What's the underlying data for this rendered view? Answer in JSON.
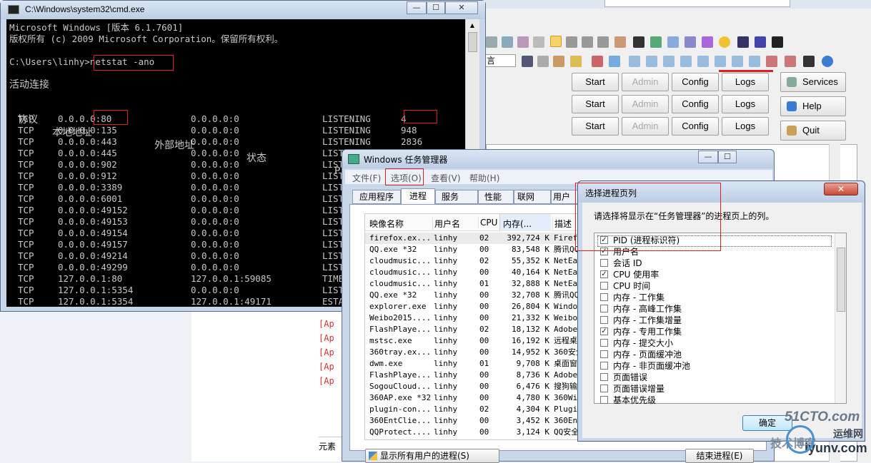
{
  "cmd": {
    "title": "C:\\Windows\\system32\\cmd.exe",
    "line1": "Microsoft Windows [版本 6.1.7601]",
    "line2": "版权所有 (c) 2009 Microsoft Corporation。保留所有权利。",
    "prompt": "C:\\Users\\linhy>",
    "command": "netstat -ano",
    "section": "活动连接",
    "headers": [
      "协议",
      "本地地址",
      "外部地址",
      "状态",
      "PID"
    ],
    "rows": [
      [
        "TCP",
        "0.0.0.0:80",
        "0.0.0.0:0",
        "LISTENING",
        "4"
      ],
      [
        "TCP",
        "0.0.0.0:135",
        "0.0.0.0:0",
        "LISTENING",
        "948"
      ],
      [
        "TCP",
        "0.0.0.0:443",
        "0.0.0.0:0",
        "LISTENING",
        "2836"
      ],
      [
        "TCP",
        "0.0.0.0:445",
        "0.0.0.0:0",
        "LIST",
        ""
      ],
      [
        "TCP",
        "0.0.0.0:902",
        "0.0.0.0:0",
        "LIST",
        ""
      ],
      [
        "TCP",
        "0.0.0.0:912",
        "0.0.0.0:0",
        "LIST",
        ""
      ],
      [
        "TCP",
        "0.0.0.0:3389",
        "0.0.0.0:0",
        "LIST",
        ""
      ],
      [
        "TCP",
        "0.0.0.0:6001",
        "0.0.0.0:0",
        "LIST",
        ""
      ],
      [
        "TCP",
        "0.0.0.0:49152",
        "0.0.0.0:0",
        "LIST",
        ""
      ],
      [
        "TCP",
        "0.0.0.0:49153",
        "0.0.0.0:0",
        "LIST",
        ""
      ],
      [
        "TCP",
        "0.0.0.0:49154",
        "0.0.0.0:0",
        "LIST",
        ""
      ],
      [
        "TCP",
        "0.0.0.0:49157",
        "0.0.0.0:0",
        "LIST",
        ""
      ],
      [
        "TCP",
        "0.0.0.0:49214",
        "0.0.0.0:0",
        "LIST",
        ""
      ],
      [
        "TCP",
        "0.0.0.0:49299",
        "0.0.0.0:0",
        "LIST",
        ""
      ],
      [
        "TCP",
        "127.0.0.1:80",
        "127.0.0.1:59085",
        "TIME",
        ""
      ],
      [
        "TCP",
        "127.0.0.1:5354",
        "0.0.0.0:0",
        "LIST",
        ""
      ],
      [
        "TCP",
        "127.0.0.1:5354",
        "127.0.0.1:49171",
        "ESTA",
        ""
      ]
    ],
    "buttons": [
      "—",
      "☐",
      "✕"
    ]
  },
  "xampp": {
    "rows": [
      {
        "start": "Start",
        "admin": "Admin",
        "config": "Config",
        "logs": "Logs"
      },
      {
        "start": "Start",
        "admin": "Admin",
        "config": "Config",
        "logs": "Logs"
      },
      {
        "start": "Start",
        "admin": "Admin",
        "config": "Config",
        "logs": "Logs"
      }
    ],
    "side": [
      "Services",
      "Help",
      "Quit"
    ],
    "toolbar_label": "言",
    "log_lines": [
      "[Ap",
      "[Ap",
      "[Ap",
      "[Ap",
      "[Ap"
    ],
    "elements_label": "元素"
  },
  "taskmgr": {
    "title": "Windows 任务管理器",
    "menu": [
      "文件(F)",
      "选项(O)",
      "查看(V)",
      "帮助(H)"
    ],
    "tabs": [
      "应用程序",
      "进程",
      "服务",
      "性能",
      "联网",
      "用户"
    ],
    "columns": [
      "映像名称",
      "用户名",
      "CPU",
      "内存(...",
      "描述"
    ],
    "rows": [
      [
        "firefox.ex...",
        "linhy",
        "02",
        "392,724 K",
        "Firefo"
      ],
      [
        "QQ.exe *32",
        "linhy",
        "00",
        "83,548 K",
        "腾讯QQ"
      ],
      [
        "cloudmusic...",
        "linhy",
        "02",
        "55,352 K",
        "NetEas"
      ],
      [
        "cloudmusic...",
        "linhy",
        "00",
        "40,164 K",
        "NetEas"
      ],
      [
        "cloudmusic...",
        "linhy",
        "01",
        "32,888 K",
        "NetEas"
      ],
      [
        "QQ.exe *32",
        "linhy",
        "00",
        "32,708 K",
        "腾讯QQ"
      ],
      [
        "explorer.exe",
        "linhy",
        "00",
        "26,804 K",
        "Window"
      ],
      [
        "Weibo2015....",
        "linhy",
        "00",
        "21,332 K",
        "Weibo2"
      ],
      [
        "FlashPlaye...",
        "linhy",
        "02",
        "18,132 K",
        "Adobe"
      ],
      [
        "mstsc.exe",
        "linhy",
        "00",
        "16,192 K",
        "远程桌"
      ],
      [
        "360tray.ex...",
        "linhy",
        "00",
        "14,952 K",
        "360安全"
      ],
      [
        "dwm.exe",
        "linhy",
        "01",
        "9,708 K",
        "桌面窗"
      ],
      [
        "FlashPlaye...",
        "linhy",
        "00",
        "8,736 K",
        "Adobe"
      ],
      [
        "SogouCloud...",
        "linhy",
        "00",
        "6,476 K",
        "搜狗输"
      ],
      [
        "360AP.exe *32",
        "linhy",
        "00",
        "4,780 K",
        "360WiF"
      ],
      [
        "plugin-con...",
        "linhy",
        "02",
        "4,304 K",
        "Plugin"
      ],
      [
        "360EntClie...",
        "linhy",
        "00",
        "3,452 K",
        "360Ent"
      ],
      [
        "QQProtect....",
        "linhy",
        "00",
        "3,124 K",
        "QQ安全"
      ]
    ],
    "show_all": "显示所有用户的进程(S)",
    "end_process": "结束进程(E)"
  },
  "dialog": {
    "title": "选择进程页列",
    "prompt": "请选择将显示在“任务管理器”的进程页上的列。",
    "items": [
      {
        "label": "PID (进程标识符)",
        "checked": true
      },
      {
        "label": "用户名",
        "checked": true
      },
      {
        "label": "会话 ID",
        "checked": false
      },
      {
        "label": "CPU 使用率",
        "checked": true
      },
      {
        "label": "CPU 时间",
        "checked": false
      },
      {
        "label": "内存 - 工作集",
        "checked": false
      },
      {
        "label": "内存 - 高峰工作集",
        "checked": false
      },
      {
        "label": "内存 - 工作集增量",
        "checked": false
      },
      {
        "label": "内存 - 专用工作集",
        "checked": true
      },
      {
        "label": "内存 - 提交大小",
        "checked": false
      },
      {
        "label": "内存 - 页面缓冲池",
        "checked": false
      },
      {
        "label": "内存 - 非页面缓冲池",
        "checked": false
      },
      {
        "label": "页面错误",
        "checked": false
      },
      {
        "label": "页面错误增量",
        "checked": false
      },
      {
        "label": "基本优先级",
        "checked": false
      }
    ],
    "ok": "确定",
    "close": "✕"
  },
  "watermark": {
    "line1": "51CTO.com",
    "line2": "运维网",
    "line3": "技术博客",
    "line4": "iyunv.com"
  }
}
